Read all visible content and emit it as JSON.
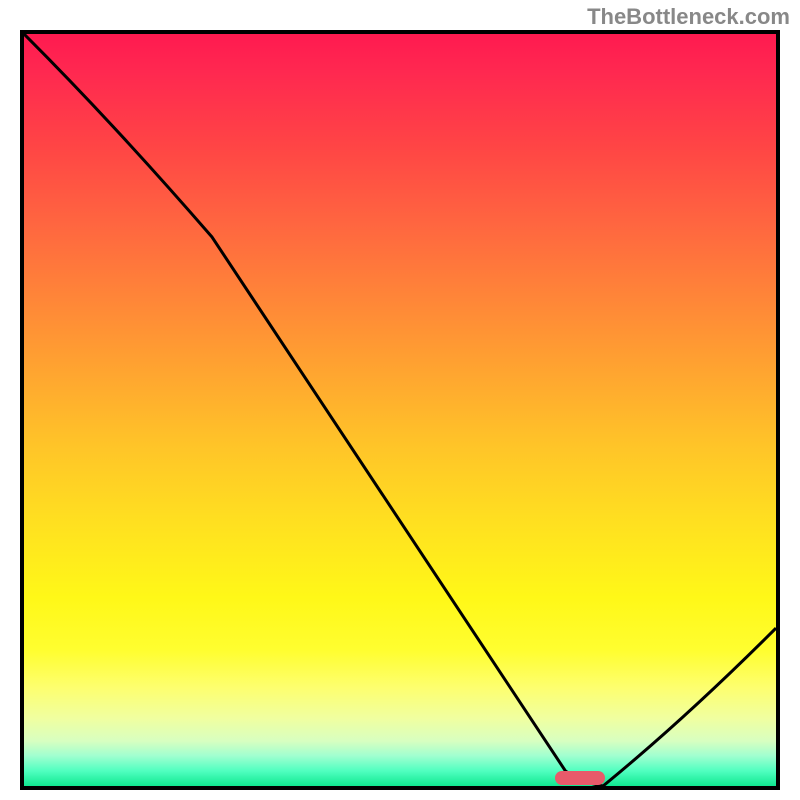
{
  "watermark": "TheBottleneck.com",
  "chart_data": {
    "type": "line",
    "title": "",
    "xlabel": "",
    "ylabel": "",
    "xlim": [
      0,
      100
    ],
    "ylim": [
      0,
      100
    ],
    "x": [
      0,
      25,
      72,
      77,
      100
    ],
    "values": [
      100,
      73,
      2,
      0,
      21
    ],
    "marker": {
      "x": 74,
      "y": 1,
      "color": "#e85a6a"
    },
    "gradient": {
      "top": "#ff1a50",
      "middle": "#ffe020",
      "bottom": "#10e890"
    }
  }
}
